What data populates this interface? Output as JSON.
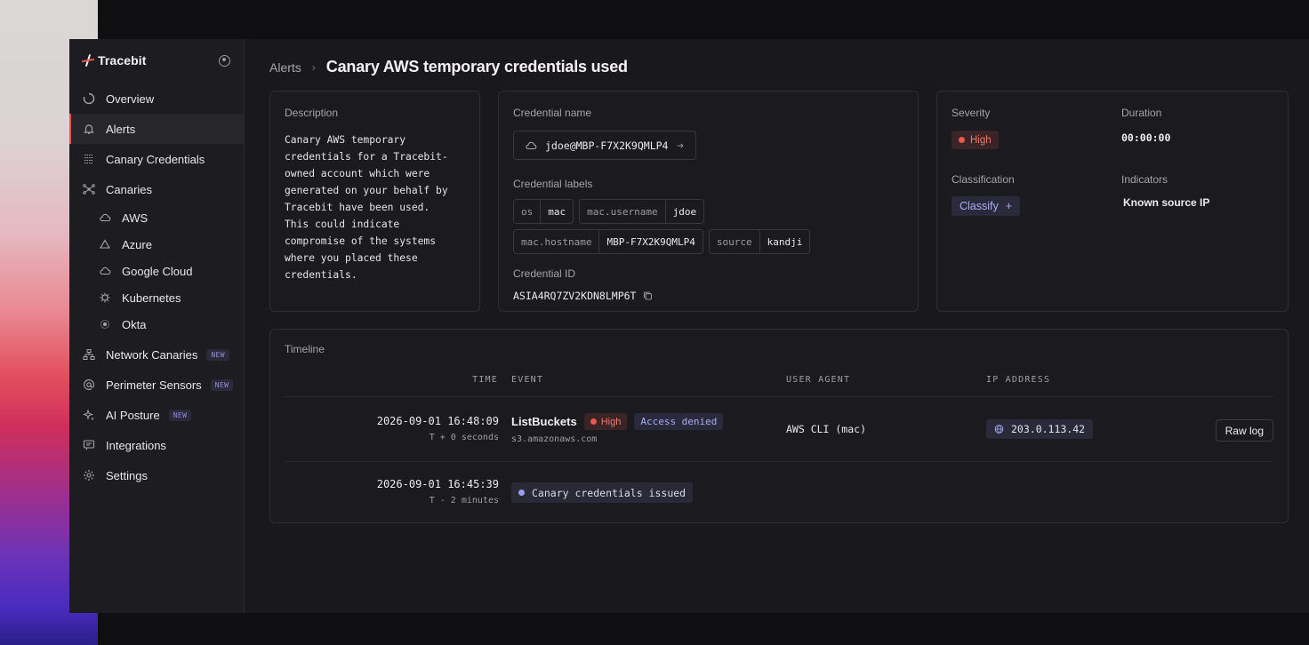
{
  "brand": {
    "name": "Tracebit"
  },
  "sidebar": {
    "items": [
      {
        "label": "Overview"
      },
      {
        "label": "Alerts"
      },
      {
        "label": "Canary Credentials"
      },
      {
        "label": "Canaries"
      },
      {
        "label": "AWS"
      },
      {
        "label": "Azure"
      },
      {
        "label": "Google Cloud"
      },
      {
        "label": "Kubernetes"
      },
      {
        "label": "Okta"
      },
      {
        "label": "Network Canaries",
        "badge": "NEW"
      },
      {
        "label": "Perimeter Sensors",
        "badge": "NEW"
      },
      {
        "label": "AI Posture",
        "badge": "NEW"
      },
      {
        "label": "Integrations"
      },
      {
        "label": "Settings"
      }
    ]
  },
  "header": {
    "breadcrumb_parent": "Alerts",
    "separator": "›",
    "title": "Canary AWS temporary credentials used"
  },
  "description": {
    "label": "Description",
    "text_lines": [
      "Canary AWS temporary",
      "credentials for a Tracebit-",
      "owned account which were",
      "generated on your behalf by",
      "Tracebit have been used.",
      "This could indicate",
      "compromise of the systems",
      "where you placed these",
      "credentials."
    ]
  },
  "credential": {
    "name_label": "Credential name",
    "name": "jdoe@MBP-F7X2K9QMLP4",
    "labels_label": "Credential labels",
    "labels": [
      {
        "key": "os",
        "value": "mac"
      },
      {
        "key": "mac.username",
        "value": "jdoe"
      },
      {
        "key": "mac.hostname",
        "value": "MBP-F7X2K9QMLP4"
      },
      {
        "key": "source",
        "value": "kandji"
      }
    ],
    "id_label": "Credential ID",
    "id": "ASIA4RQ7ZV2KDN8LMP6T"
  },
  "summary": {
    "severity_label": "Severity",
    "severity": "High",
    "duration_label": "Duration",
    "duration": "00:00:00",
    "classification_label": "Classification",
    "classify_button": "Classify",
    "classify_plus": "+",
    "indicators_label": "Indicators",
    "indicator": "Known source IP"
  },
  "timeline": {
    "label": "Timeline",
    "columns": {
      "time": "TIME",
      "event": "EVENT",
      "user_agent": "USER AGENT",
      "ip": "IP ADDRESS"
    },
    "rows": [
      {
        "time": "2026-09-01 16:48:09",
        "offset": "T + 0 seconds",
        "event": "ListBuckets",
        "severity": "High",
        "status": "Access denied",
        "source": "s3.amazonaws.com",
        "user_agent": "AWS CLI (mac)",
        "ip": "203.0.113.42",
        "action": "Raw log"
      },
      {
        "time": "2026-09-01 16:45:39",
        "offset": "T - 2 minutes",
        "event": "Canary credentials issued"
      }
    ]
  },
  "colors": {
    "accent": "#e0574e",
    "high": "#ea5a48",
    "purple": "#a9adf2",
    "background": "#19181c"
  }
}
